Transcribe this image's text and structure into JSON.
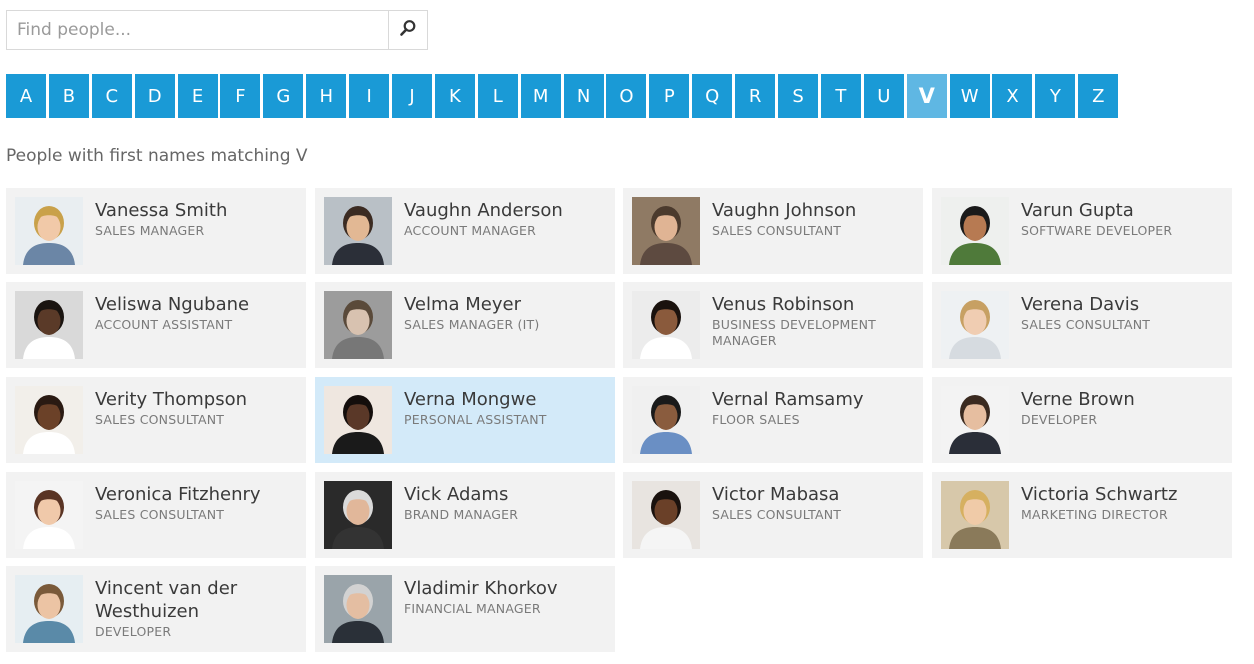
{
  "search": {
    "placeholder": "Find people...",
    "icon": "search-icon"
  },
  "alphabet": {
    "letters": [
      "A",
      "B",
      "C",
      "D",
      "E",
      "F",
      "G",
      "H",
      "I",
      "J",
      "K",
      "L",
      "M",
      "N",
      "O",
      "P",
      "Q",
      "R",
      "S",
      "T",
      "U",
      "V",
      "W",
      "X",
      "Y",
      "Z"
    ],
    "selected": "V"
  },
  "caption": "People with first names matching V",
  "colors": {
    "accent": "#1a9ad6",
    "accent_selected": "#5fb7e3",
    "card_bg": "#f2f2f2",
    "card_highlight": "#d3eaf9"
  },
  "people": [
    {
      "name": "Vanessa Smith",
      "title": "SALES MANAGER",
      "photo": {
        "bg": "#e9eef1",
        "hair": "#c9a14a",
        "skin": "#f1c9a8",
        "shirt": "#6b86a6"
      }
    },
    {
      "name": "Vaughn Anderson",
      "title": "ACCOUNT MANAGER",
      "photo": {
        "bg": "#b9c0c6",
        "hair": "#3b2b22",
        "skin": "#e2b894",
        "shirt": "#2b2f38"
      }
    },
    {
      "name": "Vaughn Johnson",
      "title": "SALES CONSULTANT",
      "photo": {
        "bg": "#8f7a64",
        "hair": "#4b3a2d",
        "skin": "#e0b494",
        "shirt": "#5d4a40"
      }
    },
    {
      "name": "Varun Gupta",
      "title": "SOFTWARE DEVELOPER",
      "photo": {
        "bg": "#eef0ee",
        "hair": "#1a1a1a",
        "skin": "#b77a52",
        "shirt": "#4f7a3a"
      }
    },
    {
      "name": "Veliswa Ngubane",
      "title": "ACCOUNT ASSISTANT",
      "photo": {
        "bg": "#d9d9d9",
        "hair": "#1a1410",
        "skin": "#5a3a28",
        "shirt": "#ffffff"
      }
    },
    {
      "name": "Velma Meyer",
      "title": "SALES MANAGER (IT)",
      "photo": {
        "bg": "#9c9c9c",
        "hair": "#5a4a3a",
        "skin": "#d8c2b0",
        "shirt": "#777777"
      }
    },
    {
      "name": "Venus Robinson",
      "title": "BUSINESS DEVELOPMENT MANAGER",
      "photo": {
        "bg": "#ececec",
        "hair": "#1a120e",
        "skin": "#8a5a3c",
        "shirt": "#ffffff"
      }
    },
    {
      "name": "Verena Davis",
      "title": "SALES CONSULTANT",
      "photo": {
        "bg": "#eef1f3",
        "hair": "#c7a063",
        "skin": "#f0cdb2",
        "shirt": "#d6dbe0"
      }
    },
    {
      "name": "Verity Thompson",
      "title": "SALES CONSULTANT",
      "photo": {
        "bg": "#f2efea",
        "hair": "#2a1a12",
        "skin": "#6b4128",
        "shirt": "#ffffff"
      }
    },
    {
      "name": "Verna Mongwe",
      "title": "PERSONAL ASSISTANT",
      "photo": {
        "bg": "#efe7e0",
        "hair": "#140e0c",
        "skin": "#5a3828",
        "shirt": "#1a1a1a"
      }
    },
    {
      "name": "Vernal Ramsamy",
      "title": "FLOOR SALES",
      "photo": {
        "bg": "#f0f0f0",
        "hair": "#1a1a1a",
        "skin": "#8a5c3e",
        "shirt": "#6a8fc4"
      }
    },
    {
      "name": "Verne Brown",
      "title": "DEVELOPER",
      "photo": {
        "bg": "#f3f3f3",
        "hair": "#3a2a20",
        "skin": "#e6bea0",
        "shirt": "#2a2e38"
      }
    },
    {
      "name": "Veronica Fitzhenry",
      "title": "SALES CONSULTANT",
      "photo": {
        "bg": "#f4f4f4",
        "hair": "#5a3424",
        "skin": "#f0c9aa",
        "shirt": "#ffffff"
      }
    },
    {
      "name": "Vick Adams",
      "title": "BRAND MANAGER",
      "photo": {
        "bg": "#2a2a2a",
        "hair": "#dadada",
        "skin": "#e1b79a",
        "shirt": "#333333"
      }
    },
    {
      "name": "Victor Mabasa",
      "title": "SALES CONSULTANT",
      "photo": {
        "bg": "#e8e4e0",
        "hair": "#1a120e",
        "skin": "#6a4028",
        "shirt": "#f5f5f5"
      }
    },
    {
      "name": "Victoria Schwartz",
      "title": "MARKETING DIRECTOR",
      "photo": {
        "bg": "#d7c8aa",
        "hair": "#d6b060",
        "skin": "#f0cba8",
        "shirt": "#8a7a5a"
      }
    },
    {
      "name": "Vincent van der Westhuizen",
      "title": "DEVELOPER",
      "photo": {
        "bg": "#e6eef2",
        "hair": "#7a5a3a",
        "skin": "#ecc4a4",
        "shirt": "#5a8aa8"
      }
    },
    {
      "name": "Vladimir Khorkov",
      "title": "FINANCIAL MANAGER",
      "photo": {
        "bg": "#9aa4aa",
        "hair": "#d2d2d2",
        "skin": "#e4bea2",
        "shirt": "#2a3038"
      }
    }
  ],
  "highlighted_index": 9
}
